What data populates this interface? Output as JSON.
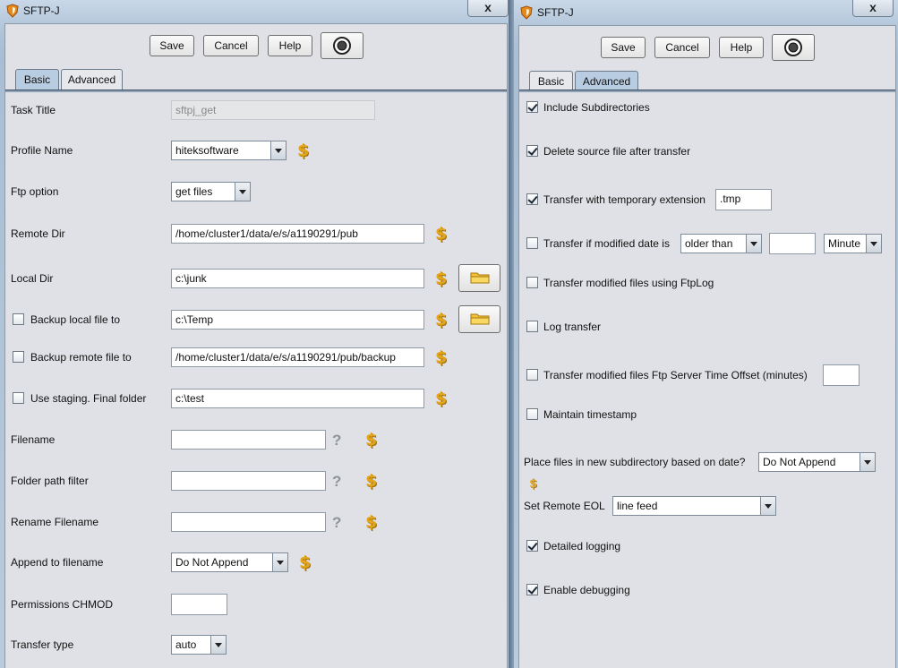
{
  "left_window": {
    "title": "SFTP-J",
    "close_label": "x",
    "buttons": {
      "save": "Save",
      "cancel": "Cancel",
      "help": "Help"
    },
    "tabs": [
      {
        "label": "Basic",
        "active": true
      },
      {
        "label": "Advanced",
        "active": false
      }
    ],
    "fields": {
      "task_title": {
        "label": "Task Title",
        "value": "sftpj_get"
      },
      "profile_name": {
        "label": "Profile Name",
        "value": "hiteksoftware"
      },
      "ftp_option": {
        "label": "Ftp option",
        "value": "get files"
      },
      "remote_dir": {
        "label": "Remote Dir",
        "value": "/home/cluster1/data/e/s/a1190291/pub"
      },
      "local_dir": {
        "label": "Local Dir",
        "value": "c:\\junk"
      },
      "backup_local": {
        "label": "Backup local file to",
        "value": "c:\\Temp",
        "checked": false
      },
      "backup_remote": {
        "label": "Backup remote file to",
        "value": "/home/cluster1/data/e/s/a1190291/pub/backup",
        "checked": false
      },
      "use_staging": {
        "label": "Use staging.  Final folder",
        "value": "c:\\test",
        "checked": false
      },
      "filename": {
        "label": "Filename",
        "value": ""
      },
      "folder_path_filter": {
        "label": "Folder path filter",
        "value": ""
      },
      "rename_filename": {
        "label": "Rename Filename",
        "value": ""
      },
      "append_to_filename": {
        "label": "Append to filename",
        "value": "Do Not Append"
      },
      "permissions_chmod": {
        "label": "Permissions CHMOD",
        "value": ""
      },
      "transfer_type": {
        "label": "Transfer type",
        "value": "auto"
      }
    },
    "help_glyph": "?",
    "variable_glyph": "$"
  },
  "right_window": {
    "title": "SFTP-J",
    "close_label": "x",
    "buttons": {
      "save": "Save",
      "cancel": "Cancel",
      "help": "Help"
    },
    "tabs": [
      {
        "label": "Basic",
        "active": false
      },
      {
        "label": "Advanced",
        "active": true
      }
    ],
    "options": {
      "include_subdirectories": {
        "label": "Include Subdirectories",
        "checked": true
      },
      "delete_source": {
        "label": "Delete source file after transfer",
        "checked": true
      },
      "temp_extension": {
        "label": "Transfer with temporary extension",
        "checked": true,
        "value": ".tmp"
      },
      "modified_date": {
        "label": "Transfer if modified date is",
        "checked": false,
        "comparison": "older than",
        "amount": "",
        "unit": "Minute"
      },
      "ftplog": {
        "label": "Transfer modified files using FtpLog",
        "checked": false
      },
      "log_transfer": {
        "label": "Log transfer",
        "checked": false
      },
      "server_offset": {
        "label": "Transfer modified files  Ftp Server Time Offset (minutes)",
        "checked": false,
        "value": ""
      },
      "maintain_timestamp": {
        "label": "Maintain timestamp",
        "checked": false
      },
      "date_subdirectory": {
        "label": "Place files in new subdirectory based on date?",
        "value": "Do Not Append"
      },
      "remote_eol": {
        "label": "Set Remote EOL",
        "value": "line feed"
      },
      "detailed_logging": {
        "label": "Detailed logging",
        "checked": true
      },
      "enable_debugging": {
        "label": "Enable debugging",
        "checked": true
      }
    }
  },
  "colors": {
    "accent_tab": "#b9cde2",
    "panel": "#dfe1e6",
    "variable_icon": "#e3a51b"
  }
}
